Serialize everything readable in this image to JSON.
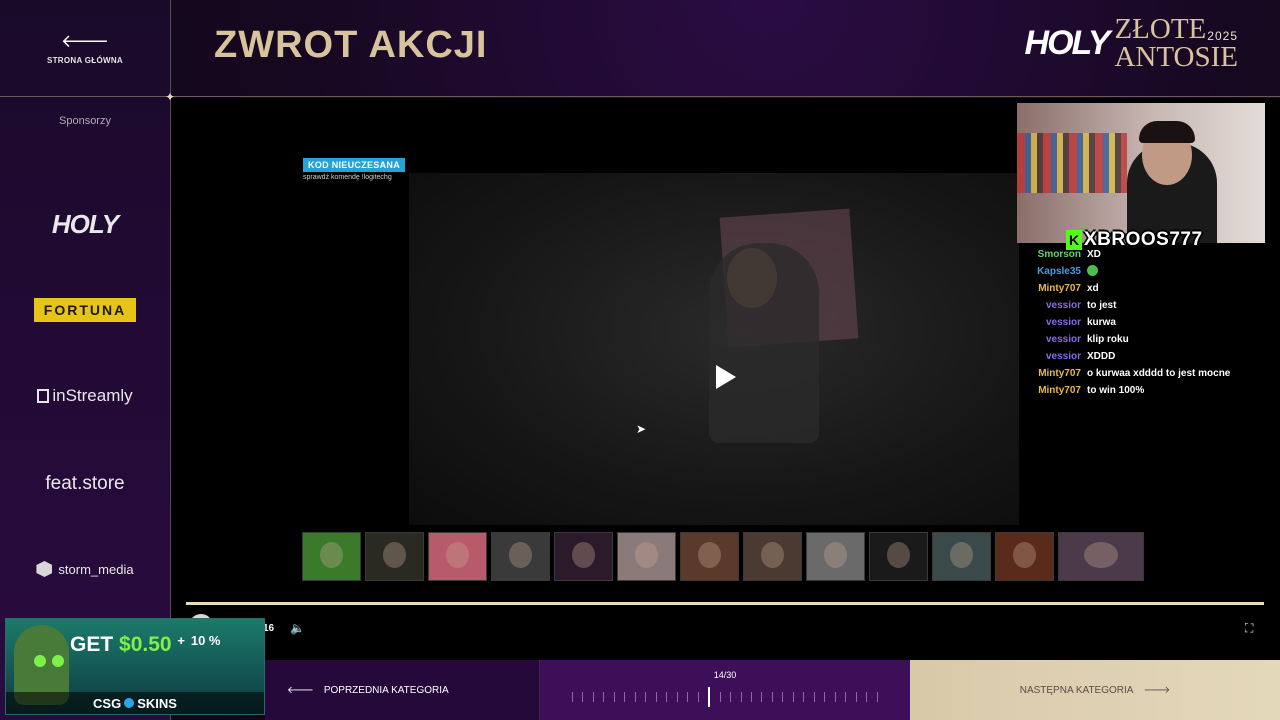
{
  "sidebar": {
    "home_label": "STRONA GŁÓWNA",
    "sponsors_title": "Sponsorzy",
    "sponsors": [
      "HOLY",
      "FORTUNA",
      "inStreamly",
      "feat.store",
      "storm_media"
    ]
  },
  "header": {
    "title": "ZWROT AKCJI",
    "brand_left": "HOLY",
    "brand_line1": "ZŁOTE",
    "brand_line2": "ANTOSIE",
    "brand_year": "2025"
  },
  "video": {
    "badge_title": "KOD NIEUCZESANA",
    "badge_sub": "sprawdź komendę !logitechg",
    "streamer_name": "XBROOS777",
    "time": "16"
  },
  "chat": [
    {
      "user": "Smorson",
      "msg": "XD",
      "color": "#6ad06a"
    },
    {
      "user": "Kapsle35",
      "msg": "",
      "color": "#4a9ae8",
      "emote": true
    },
    {
      "user": "Minty707",
      "msg": "xd",
      "color": "#e8b84a"
    },
    {
      "user": "vessior",
      "msg": "to jest",
      "color": "#8a6ae8"
    },
    {
      "user": "vessior",
      "msg": "kurwa",
      "color": "#8a6ae8"
    },
    {
      "user": "vessior",
      "msg": "klip roku",
      "color": "#8a6ae8"
    },
    {
      "user": "vessior",
      "msg": "XDDD",
      "color": "#8a6ae8"
    },
    {
      "user": "Minty707",
      "msg": "o kurwaa xdddd to jest mocne",
      "color": "#e8b84a"
    },
    {
      "user": "Minty707",
      "msg": "to win 100%",
      "color": "#e8b84a"
    }
  ],
  "thumbnails": [
    {
      "color": "#3a7a2a"
    },
    {
      "color": "#2a2a22"
    },
    {
      "color": "#b85a6a"
    },
    {
      "color": "#3a3a3a"
    },
    {
      "color": "#2a1a2a"
    },
    {
      "color": "#8a7a7a"
    },
    {
      "color": "#5a3a2a"
    },
    {
      "color": "#4a3a32"
    },
    {
      "color": "#6a6a6a"
    },
    {
      "color": "#1a1a1a"
    },
    {
      "color": "#3a4a4a"
    },
    {
      "color": "#5a2a1a"
    },
    {
      "color": "#4a3a4a",
      "wide": true
    }
  ],
  "ad": {
    "prefix": "GET",
    "amount": "$0.50",
    "plus": "+",
    "percent": "10 %",
    "brand_left": "CSG",
    "brand_right": "SKINS"
  },
  "nav": {
    "prev_label": "POPRZEDNIA KATEGORIA",
    "counter": "14/30",
    "current": 14,
    "total": 30,
    "next_label": "NASTĘPNA KATEGORIA"
  }
}
